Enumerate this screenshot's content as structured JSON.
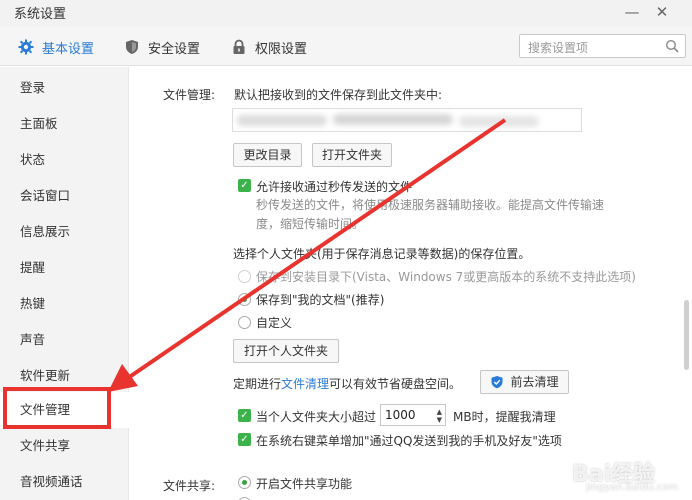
{
  "window": {
    "title": "系统设置"
  },
  "tabs": [
    {
      "label": "基本设置",
      "icon": "gear-icon",
      "active": true
    },
    {
      "label": "安全设置",
      "icon": "shield-icon",
      "active": false
    },
    {
      "label": "权限设置",
      "icon": "lock-icon",
      "active": false
    }
  ],
  "search": {
    "placeholder": "搜索设置项",
    "icon": "search-icon"
  },
  "sidebar": {
    "items": [
      {
        "label": "登录"
      },
      {
        "label": "主面板"
      },
      {
        "label": "状态"
      },
      {
        "label": "会话窗口"
      },
      {
        "label": "信息展示"
      },
      {
        "label": "提醒"
      },
      {
        "label": "热键"
      },
      {
        "label": "声音"
      },
      {
        "label": "软件更新"
      },
      {
        "label": "文件管理",
        "selected": true
      },
      {
        "label": "文件共享"
      },
      {
        "label": "音视频通话"
      }
    ]
  },
  "file_management": {
    "section_label": "文件管理:",
    "save_desc": "默认把接收到的文件保存到此文件夹中:",
    "change_dir_button": "更改目录",
    "open_folder_button": "打开文件夹",
    "allow_fast_transfer": "允许接收通过秒传发送的文件",
    "allow_fast_transfer_checked": true,
    "fast_transfer_hint": "秒传发送的文件，将使用极速服务器辅助接收。能提高文件传输速度，缩短传输时间。",
    "personal_folder_desc": "选择个人文件夹(用于保存消息记录等数据)的保存位置。",
    "radio_options": [
      {
        "label": "保存到安装目录下(Vista、Windows 7或更高版本的系统不支持此选项)",
        "state": "disabled"
      },
      {
        "label": "保存到\"我的文档\"(推荐)",
        "state": "selected"
      },
      {
        "label": "自定义",
        "state": "unselected"
      }
    ],
    "open_personal_folder_button": "打开个人文件夹",
    "cleanup_prefix": "定期进行",
    "cleanup_link": "文件清理",
    "cleanup_suffix": "可以有效节省硬盘空间。",
    "cleanup_button": "前去清理",
    "size_limit_prefix": "当个人文件夹大小超过",
    "size_limit_value": "1000",
    "size_limit_suffix": "MB时，提醒我清理",
    "size_limit_checked": true,
    "context_menu_option": "在系统右键菜单增加\"通过QQ发送到我的手机及好友\"选项",
    "context_menu_checked": true
  },
  "file_sharing": {
    "section_label": "文件共享:",
    "enable_option": "开启文件共享功能"
  },
  "watermark": {
    "text": "Bai经验",
    "subtext": "jingyan.baidu.com"
  },
  "colors": {
    "accent": "#2a7bd6",
    "check_green": "#3bb24a",
    "annotation_red": "#e8332e"
  }
}
